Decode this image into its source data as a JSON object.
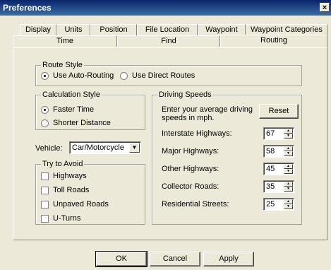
{
  "window": {
    "title": "Preferences",
    "close_glyph": "×"
  },
  "tabs_row1": [
    "Display",
    "Units",
    "Position",
    "File Location",
    "Waypoint",
    "Waypoint Categories"
  ],
  "tabs_row2": [
    "Time",
    "Find",
    "Routing"
  ],
  "active_tab": "Routing",
  "route_style": {
    "title": "Route Style",
    "options": [
      "Use Auto-Routing",
      "Use Direct Routes"
    ],
    "selected": "Use Auto-Routing"
  },
  "calculation_style": {
    "title": "Calculation Style",
    "options": [
      "Faster Time",
      "Shorter Distance"
    ],
    "selected": "Faster Time"
  },
  "vehicle": {
    "label": "Vehicle:",
    "value": "Car/Motorcycle"
  },
  "try_to_avoid": {
    "title": "Try to Avoid",
    "items": [
      "Highways",
      "Toll Roads",
      "Unpaved Roads",
      "U-Turns"
    ]
  },
  "driving_speeds": {
    "title": "Driving Speeds",
    "instruction": "Enter your average driving speeds in mph.",
    "reset_label": "Reset",
    "rows": [
      {
        "label": "Interstate Highways:",
        "value": "67"
      },
      {
        "label": "Major Highways:",
        "value": "58"
      },
      {
        "label": "Other Highways:",
        "value": "45"
      },
      {
        "label": "Collector Roads:",
        "value": "35"
      },
      {
        "label": "Residential Streets:",
        "value": "25"
      }
    ]
  },
  "buttons": {
    "ok": "OK",
    "cancel": "Cancel",
    "apply": "Apply"
  },
  "icons": {
    "dropdown": "chevron-down-icon",
    "spin_up": "spin-up-icon",
    "spin_down": "spin-down-icon",
    "close": "close-icon"
  }
}
